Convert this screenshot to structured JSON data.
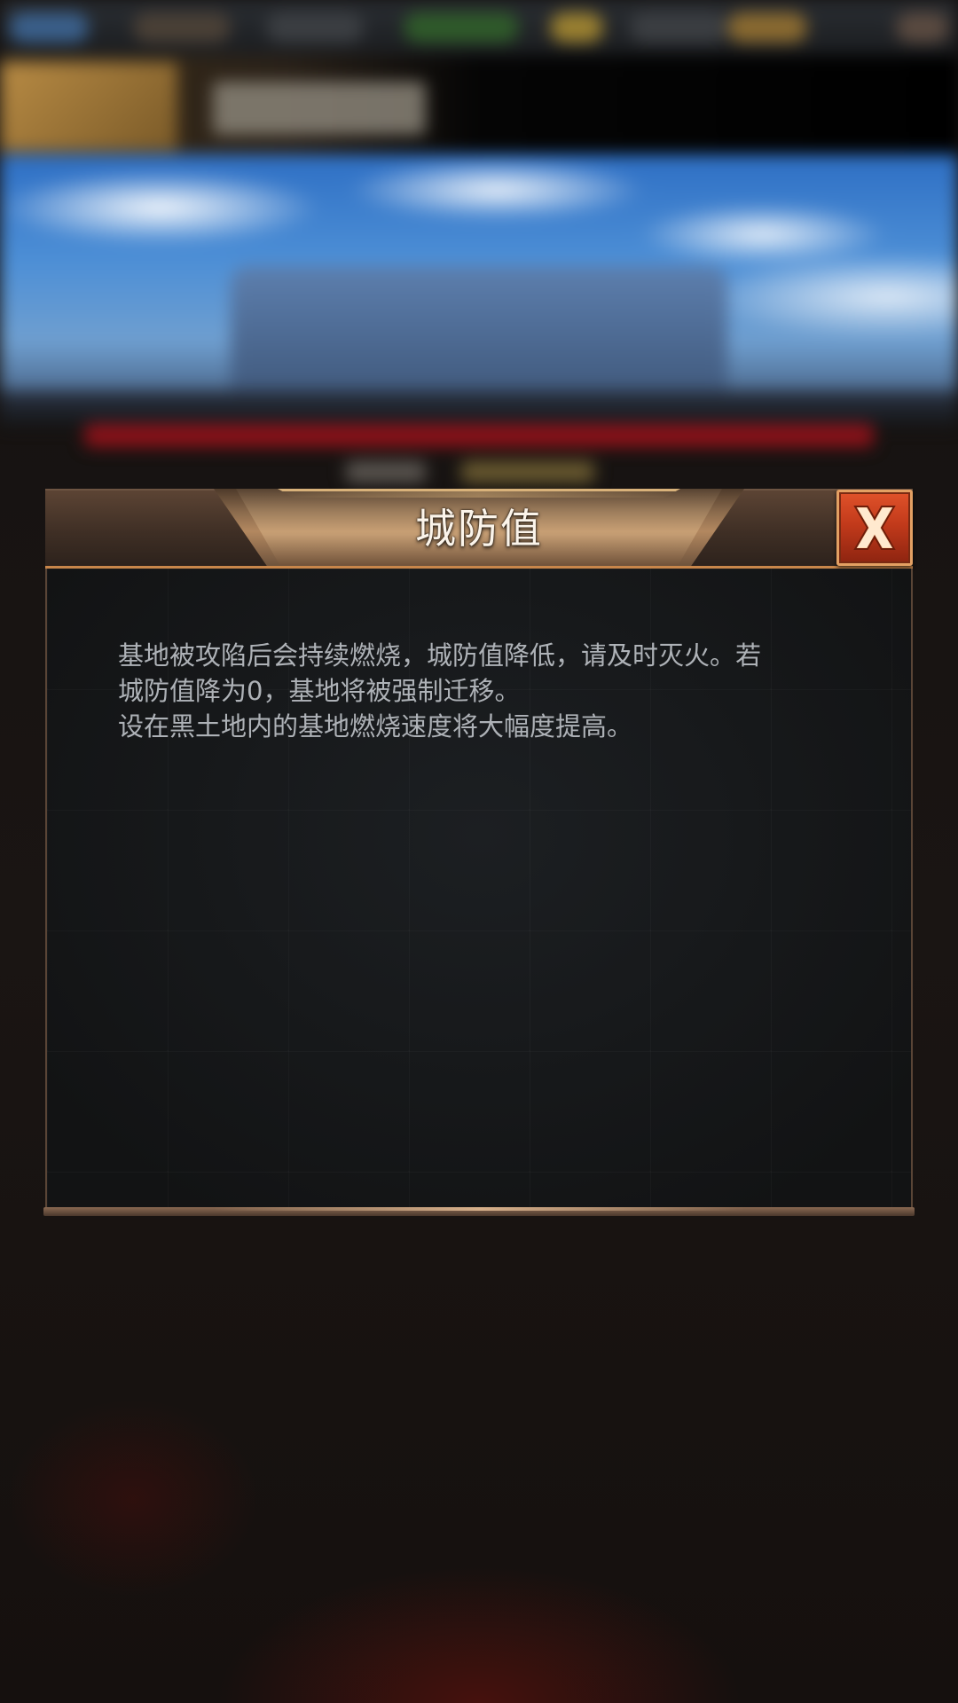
{
  "dialog": {
    "title": "城防值",
    "close_icon": "close-x-icon",
    "body_lines": [
      "基地被攻陷后会持续燃烧，城防值降低，请及时灭火。若",
      "城防值降为0，基地将被强制迁移。",
      "设在黑土地内的基地燃烧速度将大幅度提高。"
    ]
  },
  "colors": {
    "title_text": "#fbf4ea",
    "body_text": "#aeb2b7",
    "close_button": "#c23a1b",
    "header_accent": "#c8864a",
    "panel_background": "#16181a"
  }
}
